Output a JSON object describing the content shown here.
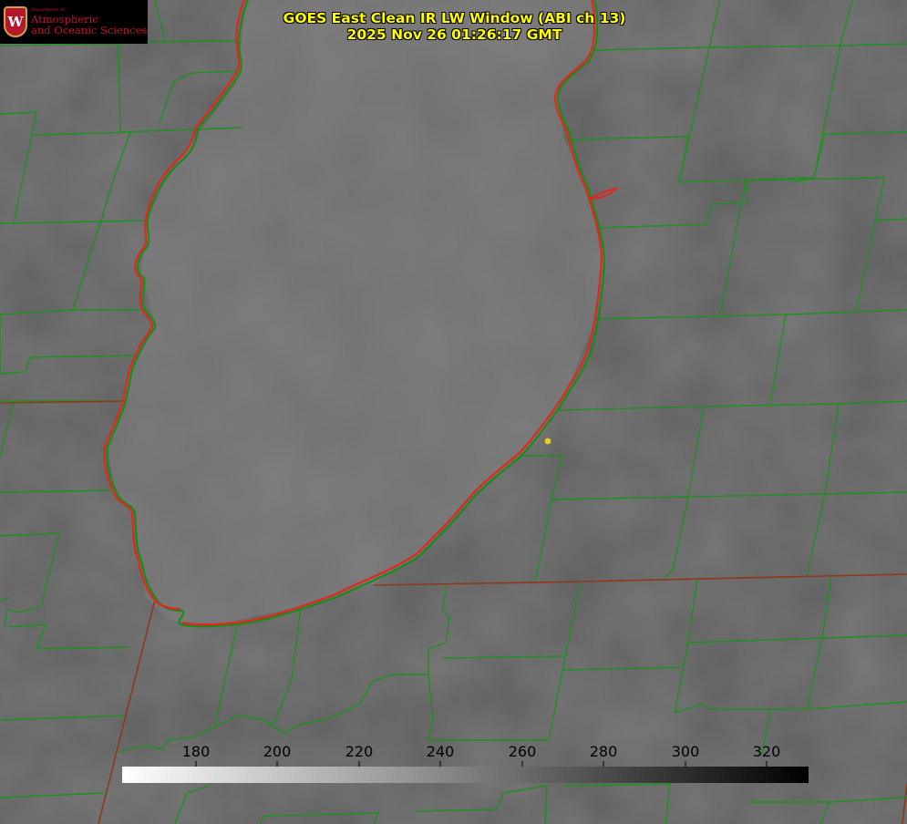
{
  "logo": {
    "dept": "Department of",
    "line1": "Atmospheric",
    "line2": "and Oceanic Sciences",
    "crest_letter": "W"
  },
  "title": {
    "line1": "GOES East Clean IR LW Window (ABI ch 13)",
    "line2": "2025 Nov 26 01:26:17 GMT"
  },
  "colorbar": {
    "ticks": [
      "180",
      "200",
      "220",
      "240",
      "260",
      "280",
      "300",
      "320"
    ],
    "range": [
      162,
      332
    ],
    "scale": "white (cold) to black (warm)"
  },
  "colors": {
    "background": "#7a7a7a",
    "county_lines": "#1a8c1a",
    "shoreline": "#e0201a",
    "marker": "#e6d21a",
    "title": "#ffff00"
  }
}
